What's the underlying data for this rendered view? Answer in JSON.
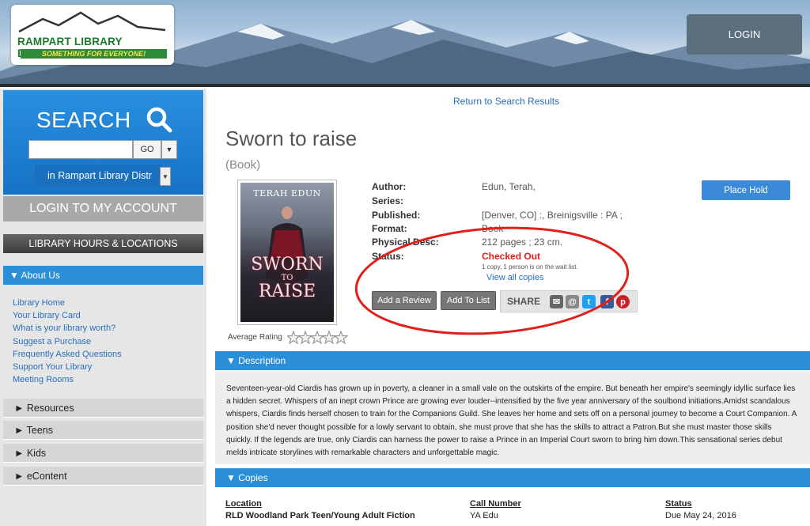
{
  "header": {
    "logo": {
      "name": "RAMPART LIBRARY DISTRICT",
      "tagline": "SOMETHING FOR EVERYONE!"
    },
    "login_label": "LOGIN"
  },
  "sidebar": {
    "search": {
      "title": "SEARCH",
      "input_value": "",
      "go_label": "GO",
      "scope": "in Rampart Library Distr"
    },
    "account_label": "LOGIN TO MY ACCOUNT",
    "hours_label": "LIBRARY HOURS & LOCATIONS",
    "about": {
      "label": "▼ About Us",
      "links": [
        "Library Home",
        "Your Library Card",
        "What is your library worth?",
        "Suggest a Purchase",
        "Frequently Asked Questions",
        "Support Your Library",
        "Meeting Rooms"
      ]
    },
    "categories": [
      "► Resources",
      "► Teens",
      "► Kids",
      "► eContent"
    ]
  },
  "record": {
    "return_link": "Return to Search Results",
    "title": "Sworn to raise",
    "format_type": "(Book)",
    "cover": {
      "author": "TERAH EDUN",
      "title_line1": "SWORN",
      "title_line2": "TO",
      "title_line3": "RAISE"
    },
    "average_rating_label": "Average Rating",
    "rating": 0,
    "labels": {
      "author": "Author:",
      "series": "Series:",
      "published": "Published:",
      "format": "Format:",
      "physical": "Physical Desc:",
      "status": "Status:"
    },
    "author": "Edun, Terah,",
    "series": "",
    "published": "[Denver, CO] :, Breinigsville : PA ;",
    "format": "Book",
    "physical": "212 pages ; 23 cm.",
    "status": "Checked Out",
    "status_color": "#e0201a",
    "copies_note": "1 copy, 1 person is on the wait list.",
    "view_copies": "View all copies",
    "place_hold": "Place Hold",
    "add_review": "Add a Review",
    "add_to_list": "Add To List",
    "share_label": "SHARE"
  },
  "description": {
    "header": "▼ Description",
    "text": "Seventeen-year-old Ciardis has grown up in poverty, a cleaner in a small vale on the outskirts of the empire. But beneath her empire's seemingly idyllic surface lies a hidden secret. Whispers of an inept crown Prince are growing ever louder--intensified by the five year anniversary of the soulbond initiations.Amidst scandalous whispers, Ciardis finds herself chosen to train for the Companions Guild. She leaves her home and sets off on a personal journey to become a Court Companion. A position she'd never thought possible for a lowly servant to obtain, she must prove that she has the skills to attract a Patron.But she must master those skills quickly. If the legends are true, only Ciardis can harness the power to raise a Prince in an Imperial Court sworn to bring him down.This sensational series debut melds intricate storylines with remarkable characters and unforgettable magic."
  },
  "copies": {
    "header": "▼ Copies",
    "columns": [
      "Location",
      "Call Number",
      "Status"
    ],
    "rows": [
      [
        "RLD Woodland Park Teen/Young Adult Fiction",
        "YA Edu",
        "Due May 24, 2016"
      ]
    ]
  },
  "colors": {
    "accent": "#2b8fd8",
    "annotation": "#e0201a"
  }
}
